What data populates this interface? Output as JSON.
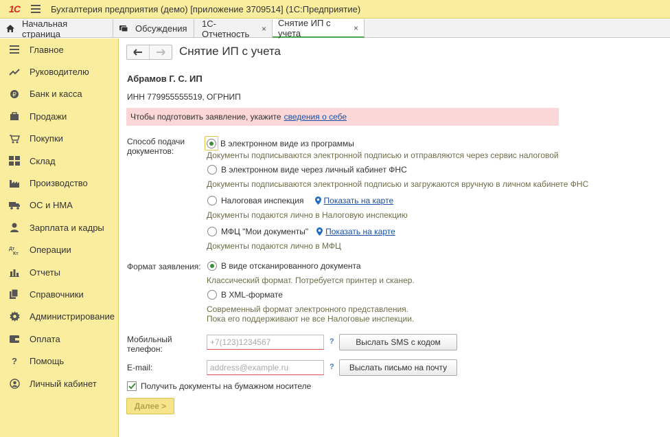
{
  "app": {
    "title": "Бухгалтерия предприятия (демо) [приложение 3709514]  (1С:Предприятие)",
    "logo_text": "1С"
  },
  "tabs": [
    {
      "label": "Начальная страница",
      "icon": "home-icon"
    },
    {
      "label": "Обсуждения",
      "icon": "chat-icon"
    },
    {
      "label": "1С-Отчетность",
      "closable": true
    },
    {
      "label": "Снятие ИП с учета",
      "closable": true,
      "active": true
    }
  ],
  "tab_close_glyph": "×",
  "sidebar": {
    "items": [
      {
        "label": "Главное",
        "icon": "menu-lines-icon"
      },
      {
        "label": "Руководителю",
        "icon": "trend-icon"
      },
      {
        "label": "Банк и касса",
        "icon": "coin-icon"
      },
      {
        "label": "Продажи",
        "icon": "bag-icon"
      },
      {
        "label": "Покупки",
        "icon": "cart-icon"
      },
      {
        "label": "Склад",
        "icon": "grid-icon"
      },
      {
        "label": "Производство",
        "icon": "factory-icon"
      },
      {
        "label": "ОС и НМА",
        "icon": "truck-icon"
      },
      {
        "label": "Зарплата и кадры",
        "icon": "person-icon"
      },
      {
        "label": "Операции",
        "icon": "operations-icon"
      },
      {
        "label": "Отчеты",
        "icon": "bar-chart-icon"
      },
      {
        "label": "Справочники",
        "icon": "books-icon"
      },
      {
        "label": "Администрирование",
        "icon": "gear-icon"
      },
      {
        "label": "Оплата",
        "icon": "wallet-icon"
      },
      {
        "label": "Помощь",
        "icon": "question-icon"
      },
      {
        "label": "Личный кабинет",
        "icon": "user-circle-icon"
      }
    ]
  },
  "form": {
    "title": "Снятие ИП с учета",
    "org_name": "Абрамов Г. С. ИП",
    "inn_line": "ИНН 779955555519, ОГРНИП",
    "warning_text": "Чтобы подготовить заявление, укажите",
    "warning_link": "сведения о себе",
    "submission_label_1": "Способ подачи",
    "submission_label_2": "документов:",
    "submission_options": [
      {
        "label": "В электронном виде из программы",
        "desc": "Документы подписываются электронной подписью и отправляются через сервис налоговой",
        "checked": true
      },
      {
        "label": "В электронном виде через личный кабинет ФНС",
        "desc": "Документы подписываются электронной подписью и загружаются вручную в личном кабинете ФНС",
        "checked": false
      },
      {
        "label": "Налоговая инспекция",
        "desc": "Документы подаются лично в Налоговую инспекцию",
        "checked": false,
        "map_link": "Показать на карте"
      },
      {
        "label": "МФЦ \"Мои документы\"",
        "desc": "Документы подаются лично в МФЦ",
        "checked": false,
        "map_link": "Показать на карте"
      }
    ],
    "format_label": "Формат заявления:",
    "format_options": [
      {
        "label": "В виде отсканированного документа",
        "desc": "Классический формат. Потребуется принтер и сканер.",
        "checked": true
      },
      {
        "label": "В XML-формате",
        "desc_1": "Современный формат электронного представления.",
        "desc_2": "Пока его поддерживают не все Налоговые инспекции.",
        "checked": false
      }
    ],
    "phone_label_1": "Мобильный",
    "phone_label_2": "телефон:",
    "phone_placeholder": "+7(123)1234567",
    "phone_value": "",
    "sms_button": "Выслать SMS с кодом",
    "email_label": "E-mail:",
    "email_placeholder": "address@example.ru",
    "email_value": "",
    "email_button": "Выслать письмо на почту",
    "help_glyph": "?",
    "paper_checkbox_label": "Получить документы на бумажном носителе",
    "paper_checkbox_checked": true,
    "next_button": "Далее >"
  }
}
